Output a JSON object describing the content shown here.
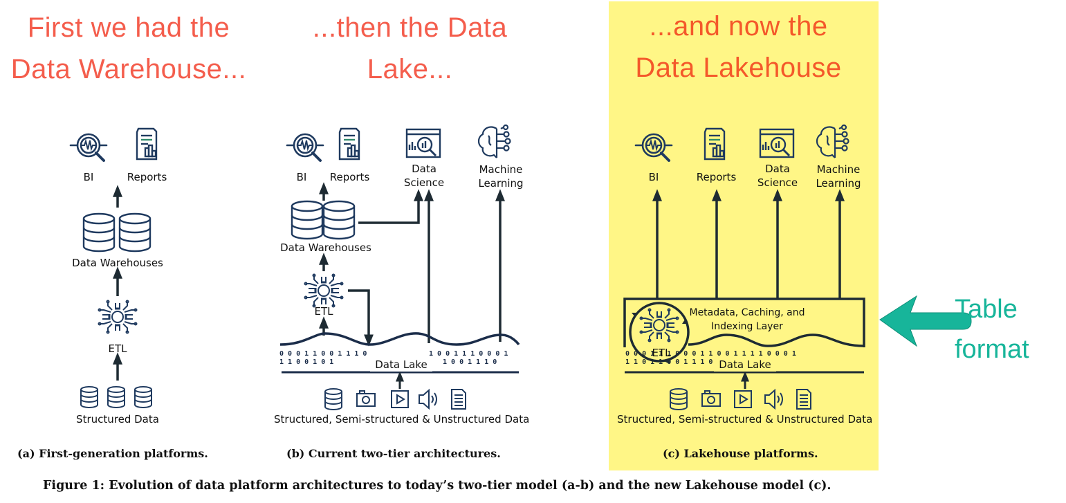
{
  "headlines": {
    "a": [
      "First we had the",
      "Data Warehouse..."
    ],
    "b": [
      "...then the Data",
      "Lake..."
    ],
    "c": [
      "...and now the",
      "Data Lakehouse"
    ]
  },
  "panel_a": {
    "consumers": [
      "BI",
      "Reports"
    ],
    "warehouse_label": "Data Warehouses",
    "etl_label": "ETL",
    "source_label": "Structured Data",
    "subcaption": "(a) First-generation platforms."
  },
  "panel_b": {
    "consumers": [
      "BI",
      "Reports",
      "Data\nScience",
      "Machine\nLearning"
    ],
    "consumer_lines": [
      [
        "BI"
      ],
      [
        "Reports"
      ],
      [
        "Data",
        "Science"
      ],
      [
        "Machine",
        "Learning"
      ]
    ],
    "warehouse_label": "Data Warehouses",
    "etl_label": "ETL",
    "lake_label": "Data Lake",
    "source_label": "Structured, Semi-structured & Unstructured Data",
    "source_icons": [
      "database-icon",
      "camera-icon",
      "video-icon",
      "audio-icon",
      "document-icon"
    ],
    "subcaption": "(b) Current two-tier architectures."
  },
  "panel_c": {
    "consumer_lines": [
      [
        "BI"
      ],
      [
        "Reports"
      ],
      [
        "Data",
        "Science"
      ],
      [
        "Machine",
        "Learning"
      ]
    ],
    "layer_label": [
      "Metadata, Caching, and",
      "Indexing Layer"
    ],
    "etl_label": "ETL",
    "lake_label": "Data Lake",
    "source_label": "Structured, Semi-structured & Unstructured Data",
    "source_icons": [
      "database-icon",
      "camera-icon",
      "video-icon",
      "audio-icon",
      "document-icon"
    ],
    "subcaption": "(c) Lakehouse platforms.",
    "highlight_color": "#fff686"
  },
  "annotation": {
    "lines": [
      "Table",
      "format"
    ],
    "color": "#17b59a"
  },
  "colors": {
    "headline": "#f45d4c",
    "headline_c": "#f4582a",
    "icon_stroke": "#1f3a5f",
    "arrow": "#1e2b33"
  },
  "caption": "Figure 1: Evolution of data platform architectures to today’s two-tier model (a-b) and the new Lakehouse model (c)."
}
